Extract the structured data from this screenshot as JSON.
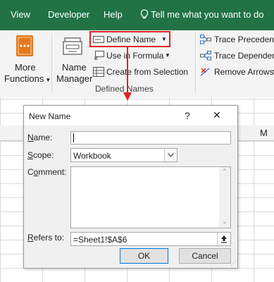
{
  "menubar": {
    "items": [
      "View",
      "Developer",
      "Help"
    ],
    "tell_me": "Tell me what you want to do"
  },
  "ribbon": {
    "more_functions": [
      "More",
      "Functions"
    ],
    "name_manager": [
      "Name",
      "Manager"
    ],
    "define_name": "Define Name",
    "use_in_formula": "Use in Formula",
    "create_from_selection": "Create from Selection",
    "group_label": "Defined Names",
    "trace_precedents": "Trace Precedents",
    "trace_dependents": "Trace Dependents",
    "remove_arrows": "Remove Arrows"
  },
  "sheet": {
    "col_m": "M"
  },
  "dialog": {
    "title": "New Name",
    "help": "?",
    "close": "✕",
    "name_label": {
      "key": "N",
      "rest": "ame:"
    },
    "name_value": "",
    "scope_label": {
      "key": "S",
      "rest": "cope:"
    },
    "scope_value": "Workbook",
    "comment_label": {
      "pre": "C",
      "key": "o",
      "rest": "mment:"
    },
    "comment_value": "",
    "refers_label": {
      "key": "R",
      "rest": "efers to:"
    },
    "refers_value": "=Sheet1!$A$6",
    "ok": "OK",
    "cancel": "Cancel"
  },
  "colors": {
    "accent": "#217346",
    "highlight": "#e0222a"
  }
}
